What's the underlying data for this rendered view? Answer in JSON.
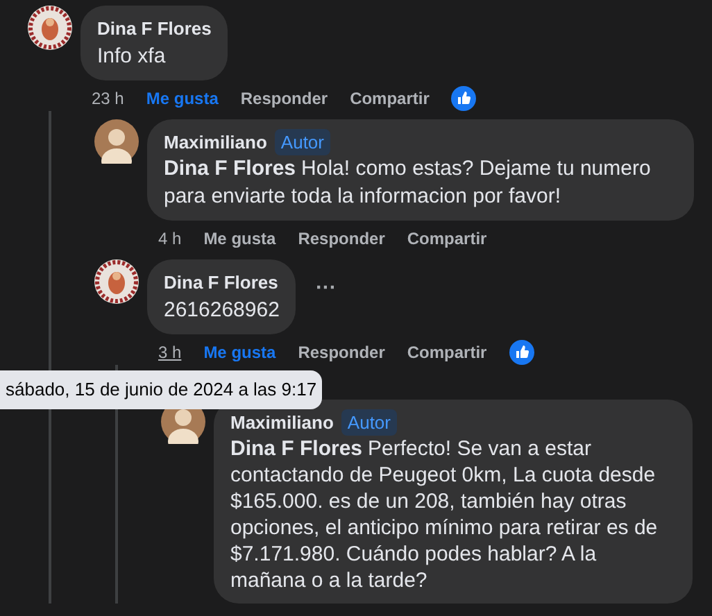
{
  "comments": [
    {
      "author": "Dina F Flores",
      "text": "Info xfa",
      "time": "23 h",
      "actions": [
        "Me gusta",
        "Responder",
        "Compartir"
      ],
      "liked": true,
      "reaction": true,
      "children": [
        {
          "author": "Maximiliano",
          "badge": "Autor",
          "mention": "Dina F Flores",
          "text": "Hola! como estas? Dejame tu numero para enviarte toda la informacion por favor!",
          "time": "4 h",
          "actions": [
            "Me gusta",
            "Responder",
            "Compartir"
          ],
          "liked": false,
          "reaction": false
        },
        {
          "author": "Dina F Flores",
          "text": "2616268962",
          "more": "···",
          "time": "3 h",
          "time_hovered": true,
          "actions": [
            "Me gusta",
            "Responder",
            "Compartir"
          ],
          "liked": true,
          "reaction": true,
          "children": [
            {
              "author": "Maximiliano",
              "badge": "Autor",
              "mention": "Dina F Flores",
              "text": "Perfecto! Se van a estar contactando de Peugeot 0km, La cuota desde $165.000. es de un 208, también hay otras opciones, el anticipo mínimo para retirar es de $7.171.980. Cuándo podes hablar? A la mañana o a la tarde?"
            }
          ]
        }
      ]
    }
  ],
  "tooltip": "sábado, 15 de junio de 2024 a las 9:17"
}
